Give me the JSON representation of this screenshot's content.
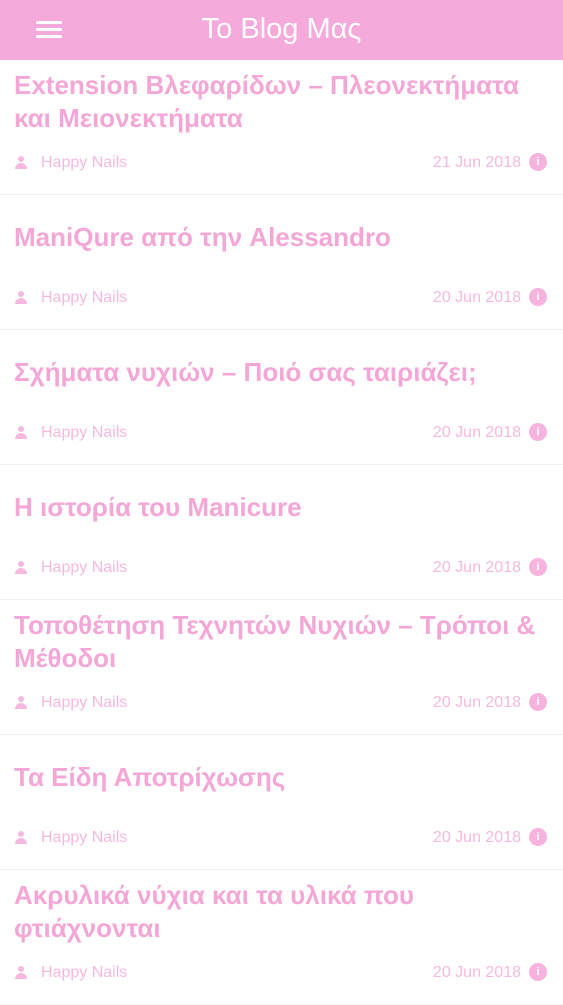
{
  "header": {
    "title": "Το Blog Μας",
    "menu_icon": "hamburger-menu-icon",
    "background_color": "#f4aadb"
  },
  "colors": {
    "accent": "#f4a7d7",
    "meta": "#f5b9df"
  },
  "posts": [
    {
      "title": "Extension Βλεφαρίδων – Πλεονεκτήματα και Μειονεκτήματα",
      "author": "Happy Nails",
      "date": "21 Jun 2018"
    },
    {
      "title": "ManiQure από την Alessandro",
      "author": "Happy Nails",
      "date": "20 Jun 2018"
    },
    {
      "title": "Σχήματα νυχιών – Ποιό σας ταιριάζει;",
      "author": "Happy Nails",
      "date": "20 Jun 2018"
    },
    {
      "title": "Η ιστορία του Manicure",
      "author": "Happy Nails",
      "date": "20 Jun 2018"
    },
    {
      "title": "Τοποθέτηση Τεχνητών Νυχιών – Τρόποι & Μέθοδοι",
      "author": "Happy Nails",
      "date": "20 Jun 2018"
    },
    {
      "title": "Τα Είδη Αποτρίχωσης",
      "author": "Happy Nails",
      "date": "20 Jun 2018"
    },
    {
      "title": "Ακρυλικά νύχια και τα υλικά που φτιάχνονται",
      "author": "Happy Nails",
      "date": "20 Jun 2018"
    }
  ]
}
